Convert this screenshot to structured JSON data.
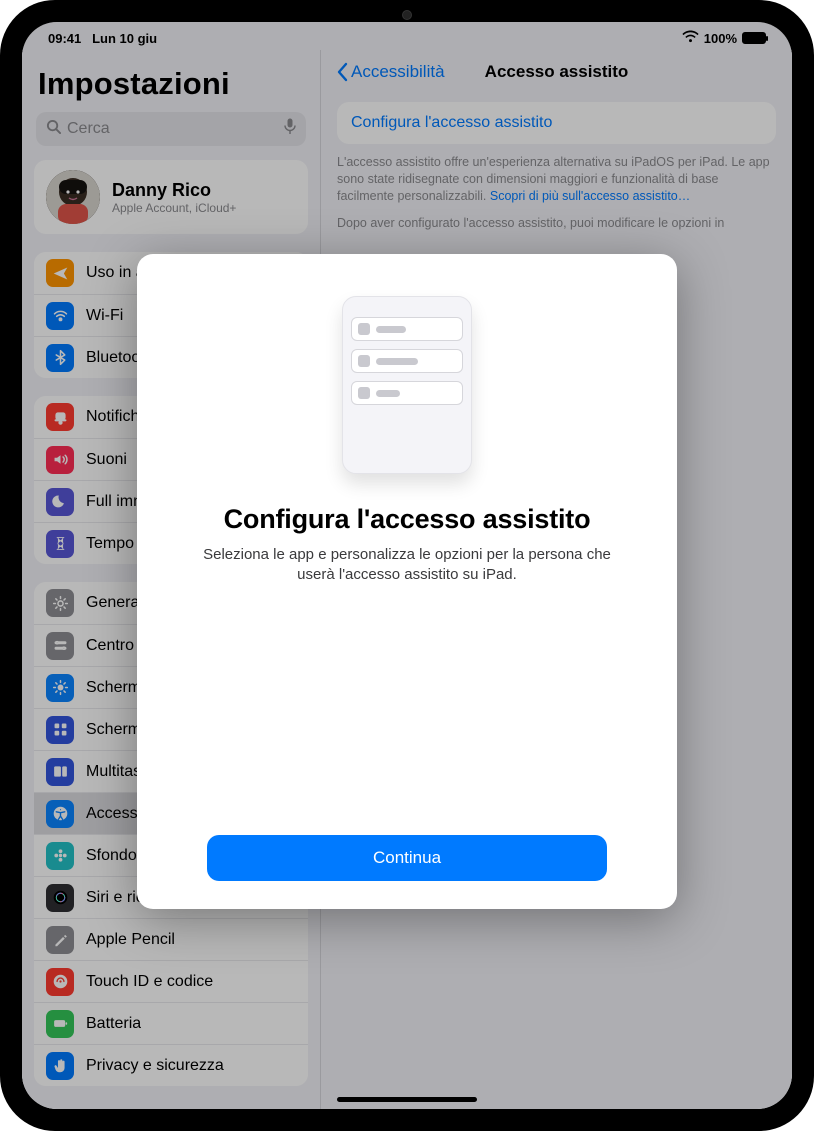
{
  "status": {
    "time": "09:41",
    "date": "Lun 10 giu",
    "battery": "100%"
  },
  "sidebar": {
    "title": "Impostazioni",
    "search_placeholder": "Cerca",
    "account": {
      "name": "Danny Rico",
      "subtitle": "Apple Account, iCloud+"
    },
    "group1": [
      {
        "label": "Uso in aereo",
        "icon": "airplane",
        "color": "#ff9500"
      },
      {
        "label": "Wi-Fi",
        "icon": "wifi",
        "color": "#007aff"
      },
      {
        "label": "Bluetooth",
        "icon": "bluetooth",
        "color": "#007aff"
      }
    ],
    "group2": [
      {
        "label": "Notifiche",
        "icon": "bell",
        "color": "#ff3b30"
      },
      {
        "label": "Suoni",
        "icon": "speaker",
        "color": "#ff2d55"
      },
      {
        "label": "Full immersion",
        "icon": "moon",
        "color": "#5856d6"
      },
      {
        "label": "Tempo di utilizzo",
        "icon": "hourglass",
        "color": "#5856d6"
      }
    ],
    "group3": [
      {
        "label": "Generali",
        "icon": "gear",
        "color": "#8e8e93"
      },
      {
        "label": "Centro di controllo",
        "icon": "switches",
        "color": "#8e8e93"
      },
      {
        "label": "Schermo e luminosità",
        "icon": "brightness",
        "color": "#0a84ff"
      },
      {
        "label": "Schermata Home e libreria app",
        "icon": "grid",
        "color": "#3355dd"
      },
      {
        "label": "Multitasking e gesti",
        "icon": "multitask",
        "color": "#3355dd"
      },
      {
        "label": "Accessibilità",
        "icon": "accessibility",
        "color": "#0a84ff",
        "selected": true
      },
      {
        "label": "Sfondo",
        "icon": "flower",
        "color": "#23c1c6"
      },
      {
        "label": "Siri e ricerca",
        "icon": "siri",
        "color": "#2f2f33"
      },
      {
        "label": "Apple Pencil",
        "icon": "pencil",
        "color": "#8e8e93"
      },
      {
        "label": "Touch ID e codice",
        "icon": "lock",
        "color": "#ff3b30"
      },
      {
        "label": "Batteria",
        "icon": "battery",
        "color": "#34c759"
      },
      {
        "label": "Privacy e sicurezza",
        "icon": "hand",
        "color": "#007aff"
      }
    ]
  },
  "detail": {
    "back_label": "Accessibilità",
    "title": "Accesso assistito",
    "card_link": "Configura l'accesso assistito",
    "para1": "L'accesso assistito offre un'esperienza alternativa su iPadOS per iPad. Le app sono state ridisegnate con dimensioni maggiori e funzionalità di base facilmente personalizzabili. ",
    "para1_more": "Scopri di più sull'accesso assistito…",
    "para2": "Dopo aver configurato l'accesso assistito, puoi modificare le opzioni in"
  },
  "modal": {
    "title": "Configura l'accesso assistito",
    "body": "Seleziona le app e personalizza le opzioni per la persona che userà l'accesso assistito su iPad.",
    "continue": "Continua"
  }
}
